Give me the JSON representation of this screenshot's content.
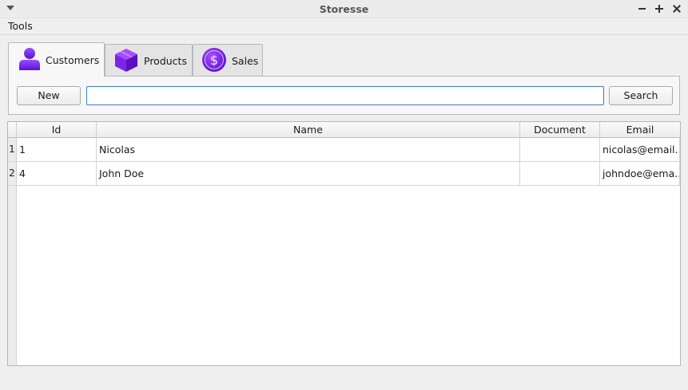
{
  "window": {
    "title": "Storesse",
    "menu_icon": "chevron-down-icon",
    "controls": [
      "minimize-icon",
      "maximize-icon",
      "close-icon"
    ]
  },
  "menubar": {
    "items": [
      "Tools"
    ]
  },
  "tabs": [
    {
      "label": "Customers",
      "icon": "user-icon",
      "active": true
    },
    {
      "label": "Products",
      "icon": "box-icon",
      "active": false
    },
    {
      "label": "Sales",
      "icon": "dollar-icon",
      "active": false
    }
  ],
  "toolbar": {
    "new_label": "New",
    "search_value": "",
    "search_placeholder": "",
    "search_label": "Search"
  },
  "table": {
    "columns": [
      "Id",
      "Name",
      "Document",
      "Email"
    ],
    "rows": [
      {
        "row_number": "1",
        "id": "1",
        "name": "Nicolas",
        "document": "",
        "email": "nicolas@email..."
      },
      {
        "row_number": "2",
        "id": "4",
        "name": "John Doe",
        "document": "",
        "email": "johndoe@ema..."
      }
    ]
  },
  "colors": {
    "accent_purple": "#7b2ff0",
    "focus_border": "#3c7bc7"
  }
}
